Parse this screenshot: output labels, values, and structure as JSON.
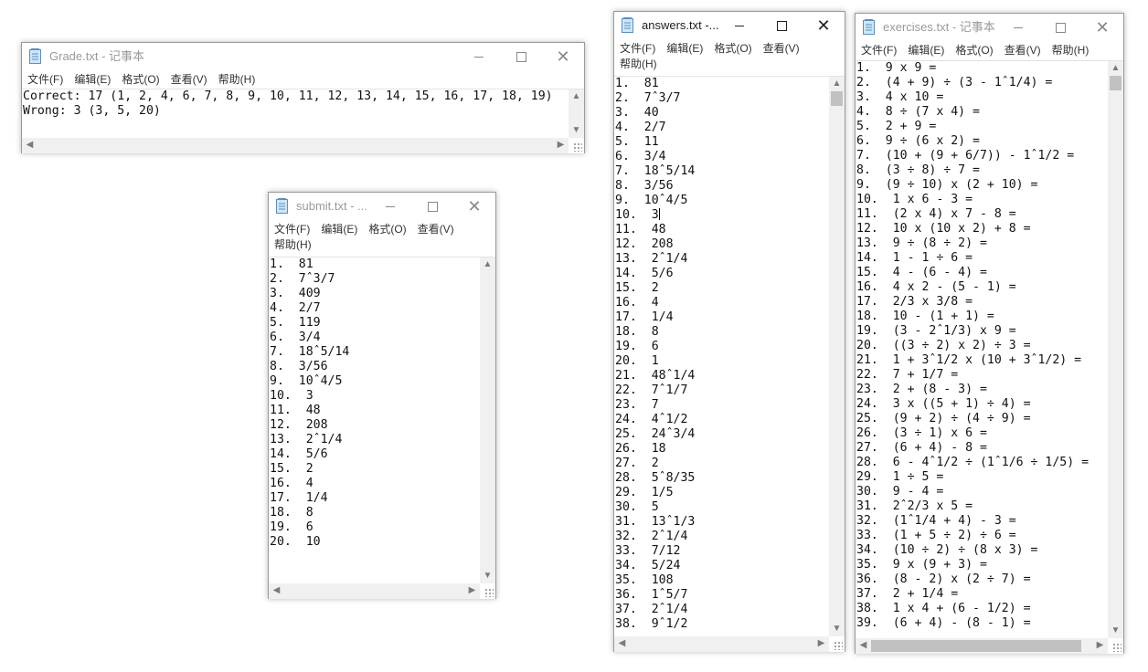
{
  "windows": {
    "grade": {
      "title": "Grade.txt - 记事本",
      "menu": [
        "文件(F)",
        "编辑(E)",
        "格式(O)",
        "查看(V)",
        "帮助(H)"
      ],
      "lines": [
        "Correct: 17 (1, 2, 4, 6, 7, 8, 9, 10, 11, 12, 13, 14, 15, 16, 17, 18, 19)",
        "Wrong: 3 (3, 5, 20)"
      ]
    },
    "submit": {
      "title": "submit.txt - ...",
      "menu": [
        "文件(F)",
        "编辑(E)",
        "格式(O)",
        "查看(V)",
        "帮助(H)"
      ],
      "lines": [
        "1.  81",
        "2.  7ˆ3/7",
        "3.  409",
        "4.  2/7",
        "5.  119",
        "6.  3/4",
        "7.  18ˆ5/14",
        "8.  3/56",
        "9.  10ˆ4/5",
        "10.  3",
        "11.  48",
        "12.  208",
        "13.  2ˆ1/4",
        "14.  5/6",
        "15.  2",
        "16.  4",
        "17.  1/4",
        "18.  8",
        "19.  6",
        "20.  10"
      ]
    },
    "answers": {
      "title": "answers.txt -...",
      "menu": [
        "文件(F)",
        "编辑(E)",
        "格式(O)",
        "查看(V)",
        "帮助(H)"
      ],
      "lines": [
        "1.  81",
        "2.  7ˆ3/7",
        "3.  40",
        "4.  2/7",
        "5.  11",
        "6.  3/4",
        "7.  18ˆ5/14",
        "8.  3/56",
        "9.  10ˆ4/5",
        "10.  3",
        "11.  48",
        "12.  208",
        "13.  2ˆ1/4",
        "14.  5/6",
        "15.  2",
        "16.  4",
        "17.  1/4",
        "18.  8",
        "19.  6",
        "20.  1",
        "21.  48ˆ1/4",
        "22.  7ˆ1/7",
        "23.  7",
        "24.  4ˆ1/2",
        "25.  24ˆ3/4",
        "26.  18",
        "27.  2",
        "28.  5ˆ8/35",
        "29.  1/5",
        "30.  5",
        "31.  13ˆ1/3",
        "32.  2ˆ1/4",
        "33.  7/12",
        "34.  5/24",
        "35.  108",
        "36.  1ˆ5/7",
        "37.  2ˆ1/4",
        "38.  9ˆ1/2"
      ]
    },
    "exercises": {
      "title": "exercises.txt - 记事本",
      "menu": [
        "文件(F)",
        "编辑(E)",
        "格式(O)",
        "查看(V)",
        "帮助(H)"
      ],
      "lines": [
        "1.  9 x 9 =",
        "2.  (4 + 9) ÷ (3 - 1ˆ1/4) =",
        "3.  4 x 10 =",
        "4.  8 ÷ (7 x 4) =",
        "5.  2 + 9 =",
        "6.  9 ÷ (6 x 2) =",
        "7.  (10 + (9 + 6/7)) - 1ˆ1/2 =",
        "8.  (3 ÷ 8) ÷ 7 =",
        "9.  (9 ÷ 10) x (2 + 10) =",
        "10.  1 x 6 - 3 =",
        "11.  (2 x 4) x 7 - 8 =",
        "12.  10 x (10 x 2) + 8 =",
        "13.  9 ÷ (8 ÷ 2) =",
        "14.  1 - 1 ÷ 6 =",
        "15.  4 - (6 - 4) =",
        "16.  4 x 2 - (5 - 1) =",
        "17.  2/3 x 3/8 =",
        "18.  10 - (1 + 1) =",
        "19.  (3 - 2ˆ1/3) x 9 =",
        "20.  ((3 ÷ 2) x 2) ÷ 3 =",
        "21.  1 + 3ˆ1/2 x (10 + 3ˆ1/2) =",
        "22.  7 + 1/7 =",
        "23.  2 + (8 - 3) =",
        "24.  3 x ((5 + 1) ÷ 4) =",
        "25.  (9 + 2) ÷ (4 ÷ 9) =",
        "26.  (3 ÷ 1) x 6 =",
        "27.  (6 + 4) - 8 =",
        "28.  6 - 4ˆ1/2 ÷ (1ˆ1/6 ÷ 1/5) =",
        "29.  1 ÷ 5 =",
        "30.  9 - 4 =",
        "31.  2ˆ2/3 x 5 =",
        "32.  (1ˆ1/4 + 4) - 3 =",
        "33.  (1 + 5 ÷ 2) ÷ 6 =",
        "34.  (10 ÷ 2) ÷ (8 x 3) =",
        "35.  9 x (9 + 3) =",
        "36.  (8 - 2) x (2 ÷ 7) =",
        "37.  2 + 1/4 =",
        "38.  1 x 4 + (6 - 1/2) =",
        "39.  (6 + 4) - (8 - 1) ="
      ]
    }
  }
}
